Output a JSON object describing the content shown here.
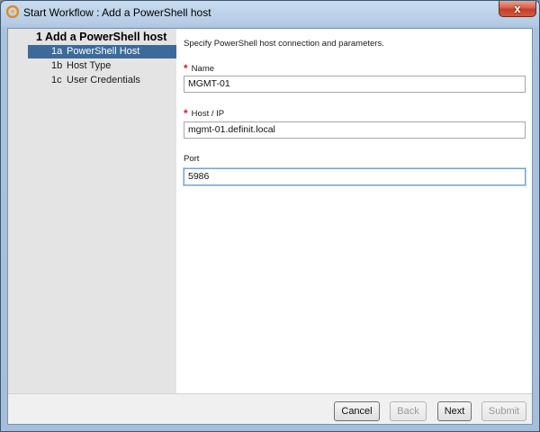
{
  "window": {
    "title": "Start Workflow : Add a PowerShell host",
    "close_glyph": "x"
  },
  "sidebar": {
    "step_title": "1  Add a PowerShell host",
    "items": [
      {
        "num": "1a",
        "label": "PowerShell Host",
        "selected": true
      },
      {
        "num": "1b",
        "label": "Host Type",
        "selected": false
      },
      {
        "num": "1c",
        "label": "User Credentials",
        "selected": false
      }
    ]
  },
  "main": {
    "instruction": "Specify PowerShell host connection and parameters.",
    "fields": [
      {
        "label": "Name",
        "required": true,
        "value": "MGMT-01"
      },
      {
        "label": "Host / IP",
        "required": true,
        "value": "mgmt-01.definit.local"
      },
      {
        "label": "Port",
        "required": false,
        "value": "5986"
      }
    ]
  },
  "footer": {
    "cancel_label": "Cancel",
    "back_label": "Back",
    "next_label": "Next",
    "submit_label": "Submit"
  },
  "colors": {
    "selection": "#3e6a9a",
    "required_star": "#d0202a",
    "sidebar_bg": "#e4e4e4"
  },
  "icons": {
    "app": "orchestrator-icon",
    "close": "close-icon",
    "required": "required-asterisk-icon"
  }
}
